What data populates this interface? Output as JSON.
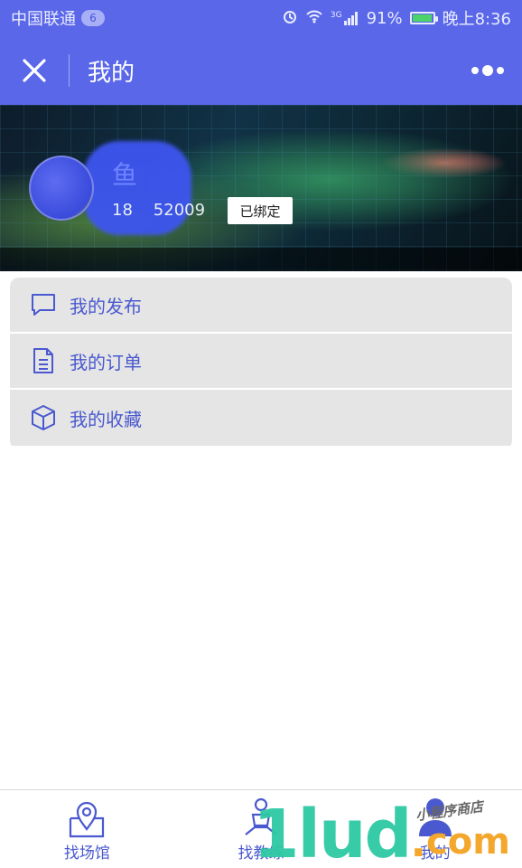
{
  "status_bar": {
    "carrier": "中国联通",
    "carrier_badge": "6",
    "network": "3G",
    "battery": "91%",
    "battery_level": 0.91,
    "time": "晚上8:36"
  },
  "title_bar": {
    "title": "我的"
  },
  "profile": {
    "username": "鱼",
    "phone": "18    52009",
    "bound_tag": "已绑定"
  },
  "menu": {
    "items": [
      {
        "label": "我的发布",
        "icon": "chat-bubble-icon"
      },
      {
        "label": "我的订单",
        "icon": "document-icon"
      },
      {
        "label": "我的收藏",
        "icon": "cube-icon"
      }
    ]
  },
  "tab_bar": {
    "tabs": [
      {
        "label": "找场馆",
        "icon": "location-pin-icon"
      },
      {
        "label": "找教练",
        "icon": "coach-icon"
      },
      {
        "label": "我的",
        "icon": "user-icon"
      }
    ]
  },
  "watermark": {
    "brand": "1lud",
    "dot": ".",
    "tld": "com",
    "tagline": "小程序商店"
  },
  "colors": {
    "primary": "#5a67e8",
    "accent_text": "#4a59cf",
    "menu_bg": "#e5e5e5"
  }
}
